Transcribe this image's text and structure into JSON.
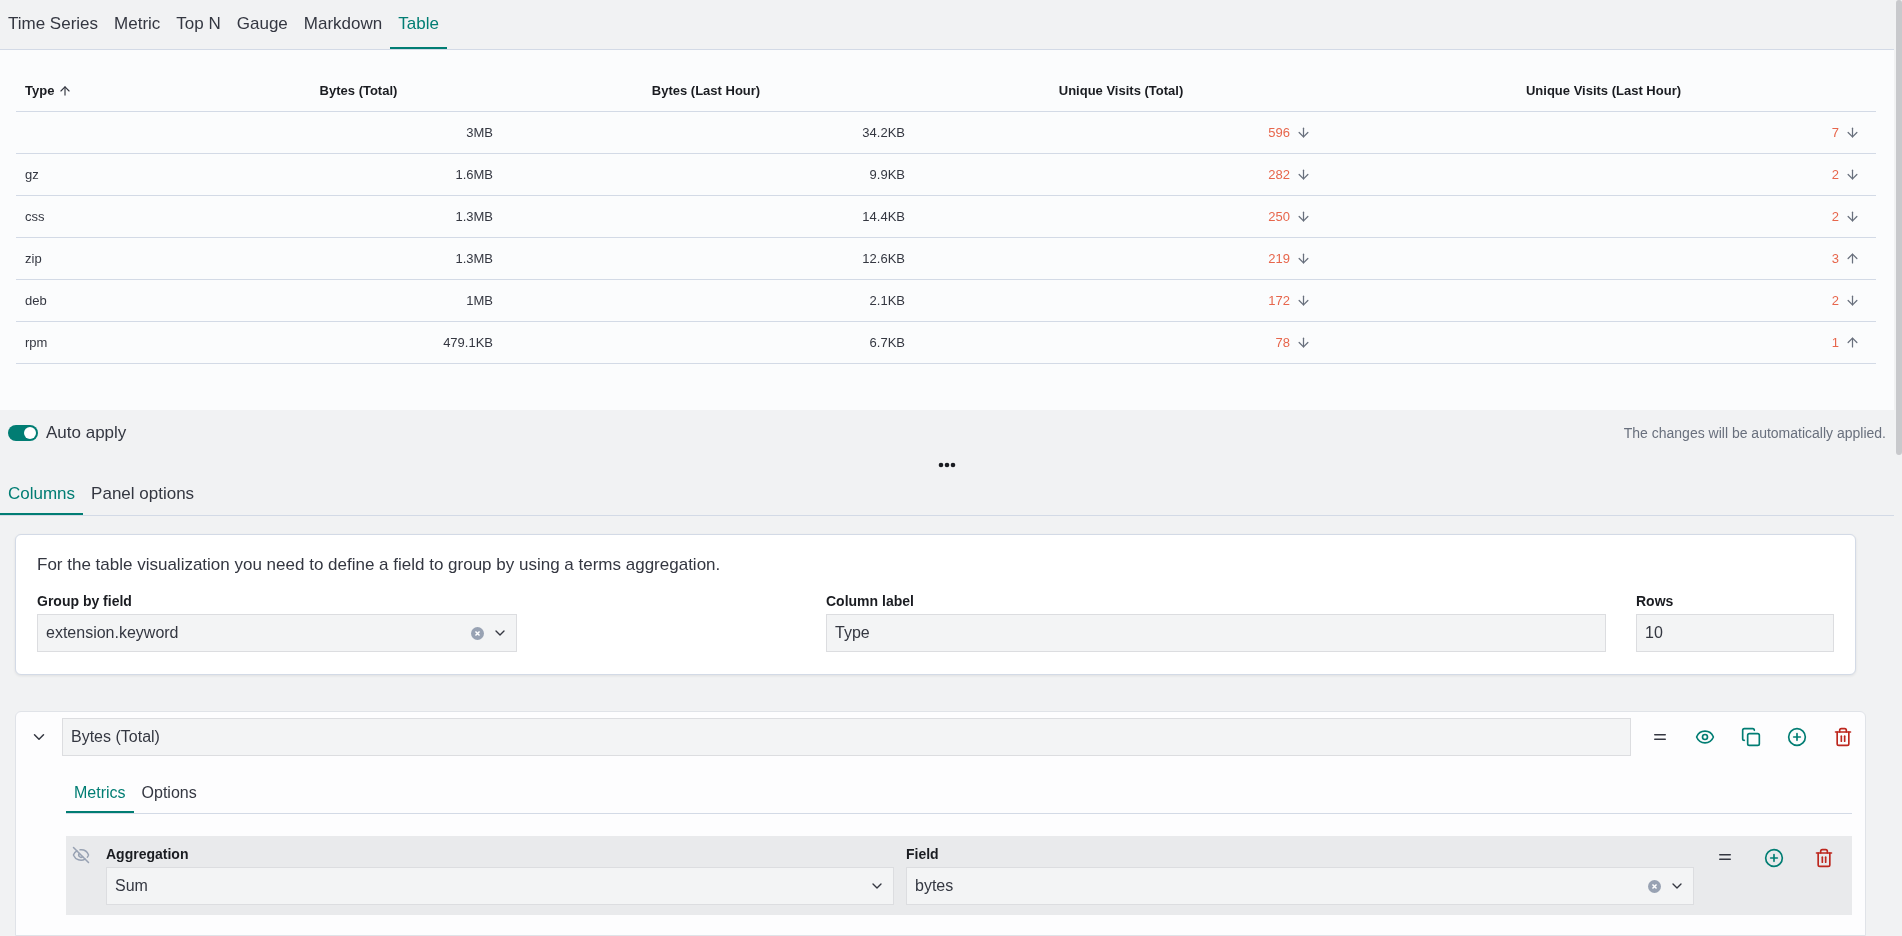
{
  "vis_tabs": [
    {
      "label": "Time Series",
      "selected": false
    },
    {
      "label": "Metric",
      "selected": false
    },
    {
      "label": "Top N",
      "selected": false
    },
    {
      "label": "Gauge",
      "selected": false
    },
    {
      "label": "Markdown",
      "selected": false
    },
    {
      "label": "Table",
      "selected": true
    }
  ],
  "table": {
    "columns": [
      {
        "label": "Type",
        "sort_ascending": true
      },
      {
        "label": "Bytes (Total)"
      },
      {
        "label": "Bytes (Last Hour)"
      },
      {
        "label": "Unique Visits (Total)"
      },
      {
        "label": "Unique Visits (Last Hour)"
      }
    ],
    "rows": [
      {
        "bytes_total": "3MB",
        "bytes_last_hour": "34.2KB",
        "visits_total": {
          "value": "596",
          "trend_up": false
        },
        "visits_last_hour": {
          "value": "7",
          "trend_up": false
        }
      },
      {
        "type": "gz",
        "bytes_total": "1.6MB",
        "bytes_last_hour": "9.9KB",
        "visits_total": {
          "value": "282",
          "trend_up": false
        },
        "visits_last_hour": {
          "value": "2",
          "trend_up": false
        }
      },
      {
        "type": "css",
        "bytes_total": "1.3MB",
        "bytes_last_hour": "14.4KB",
        "visits_total": {
          "value": "250",
          "trend_up": false
        },
        "visits_last_hour": {
          "value": "2",
          "trend_up": false
        }
      },
      {
        "type": "zip",
        "bytes_total": "1.3MB",
        "bytes_last_hour": "12.6KB",
        "visits_total": {
          "value": "219",
          "trend_up": false
        },
        "visits_last_hour": {
          "value": "3",
          "trend_up": true
        }
      },
      {
        "type": "deb",
        "bytes_total": "1MB",
        "bytes_last_hour": "2.1KB",
        "visits_total": {
          "value": "172",
          "trend_up": false
        },
        "visits_last_hour": {
          "value": "2",
          "trend_up": false
        }
      },
      {
        "type": "rpm",
        "bytes_total": "479.1KB",
        "bytes_last_hour": "6.7KB",
        "visits_total": {
          "value": "78",
          "trend_up": false
        },
        "visits_last_hour": {
          "value": "1",
          "trend_up": true
        }
      }
    ]
  },
  "auto_apply": {
    "label": "Auto apply",
    "on": true,
    "note": "The changes will be automatically applied."
  },
  "editor_tabs": [
    {
      "label": "Columns",
      "selected": true
    },
    {
      "label": "Panel options",
      "selected": false
    }
  ],
  "group_card": {
    "description": "For the table visualization you need to define a field to group by using a terms aggregation.",
    "group_by": {
      "label": "Group by field",
      "value": "extension.keyword"
    },
    "column_label": {
      "label": "Column label",
      "value": "Type"
    },
    "rows": {
      "label": "Rows",
      "value": "10"
    }
  },
  "series": [
    {
      "label": "Bytes (Total)",
      "expanded": true,
      "tabs": [
        {
          "label": "Metrics",
          "selected": true
        },
        {
          "label": "Options",
          "selected": false
        }
      ],
      "metrics": [
        {
          "aggregation": {
            "label": "Aggregation",
            "value": "Sum"
          },
          "field": {
            "label": "Field",
            "value": "bytes"
          }
        }
      ]
    }
  ]
}
